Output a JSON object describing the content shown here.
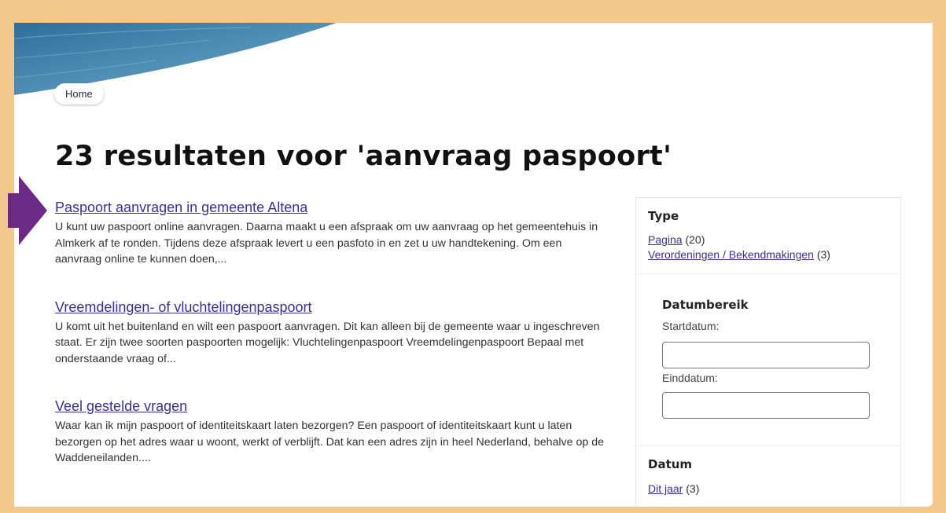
{
  "breadcrumb": {
    "home": "Home"
  },
  "page_title": "23 resultaten voor 'aanvraag paspoort'",
  "results": [
    {
      "title": "Paspoort aanvragen in gemeente Altena",
      "snippet": "U kunt uw paspoort online aanvragen. Daarna maakt u een afspraak om uw aanvraag op het gemeentehuis in Almkerk af te ronden. Tijdens deze afspraak levert u een pasfoto in en zet u uw handtekening. Om een aanvraag online te kunnen doen,..."
    },
    {
      "title": "Vreemdelingen- of vluchtelingenpaspoort",
      "snippet": "U komt uit het buitenland en wilt een paspoort aanvragen. Dit kan alleen bij de gemeente waar u ingeschreven staat. Er zijn twee soorten paspoorten mogelijk: Vluchtelingenpaspoort Vreemdelingenpaspoort Bepaal met onderstaande vraag of..."
    },
    {
      "title": "Veel gestelde vragen",
      "snippet": "Waar kan ik mijn paspoort of identiteitskaart laten bezorgen? Een paspoort of identiteitskaart kunt u laten bezorgen op het adres waar u woont, werkt of verblijft. Dat kan een adres zijn in heel Nederland, behalve op de Waddeneilanden...."
    }
  ],
  "sidebar": {
    "type": {
      "heading": "Type",
      "items": [
        {
          "label": "Pagina",
          "count": "(20)"
        },
        {
          "label": "Verordeningen / Bekendmakingen",
          "count": "(3)"
        }
      ]
    },
    "daterange": {
      "heading": "Datumbereik",
      "start_label": "Startdatum:",
      "start_value": "",
      "end_label": "Einddatum:",
      "end_value": ""
    },
    "datum": {
      "heading": "Datum",
      "items": [
        {
          "label": "Dit jaar",
          "count": "(3)"
        }
      ]
    }
  },
  "colors": {
    "frame": "#f4c78d",
    "link": "#3b3190",
    "arrow": "#6b2a86",
    "wave": "#3f7fa6"
  },
  "icons": {
    "pointer_arrow": "arrow-right-icon"
  }
}
